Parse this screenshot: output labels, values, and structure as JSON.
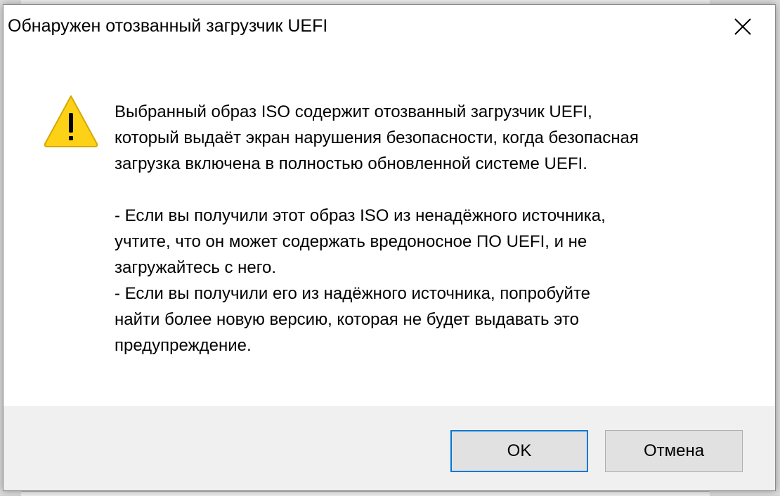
{
  "dialog": {
    "title": "Обнаружен отозванный загрузчик UEFI",
    "close_icon": "close-icon",
    "warning_icon": "warning-icon",
    "message_lines": [
      "Выбранный образ ISO содержит отозванный загрузчик UEFI,",
      "который выдаёт экран нарушения безопасности, когда безопасная",
      "загрузка включена в полностью обновленной системе UEFI.",
      "- Если вы получили этот образ ISO из ненадёжного источника,",
      "учтите, что он может содержать вредоносное ПО UEFI, и не",
      "загружайтесь с него.",
      "- Если вы получили его из надёжного источника, попробуйте",
      "найти более новую версию, которая не будет выдавать это",
      "предупреждение."
    ],
    "buttons": {
      "ok_label": "OK",
      "cancel_label": "Отмена"
    }
  },
  "colors": {
    "accent_border": "#0078d7",
    "warning_fill": "#fcd116",
    "footer_bg": "#f0f0f0"
  }
}
